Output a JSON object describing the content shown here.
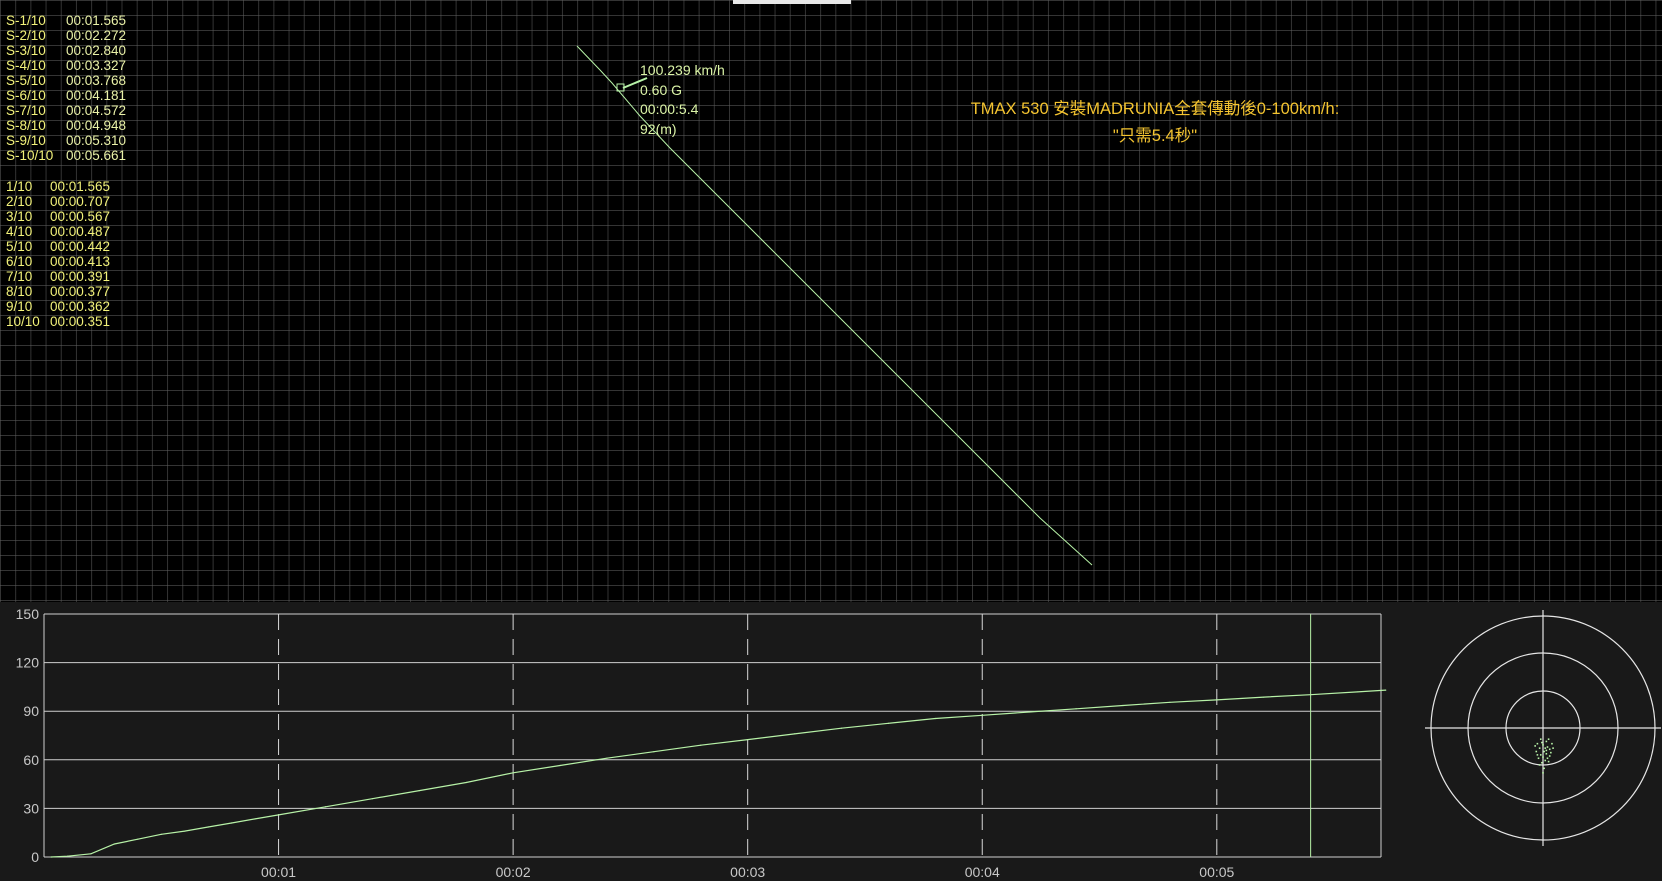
{
  "split_times": [
    {
      "label": "S-1/10",
      "time": "00:01.565"
    },
    {
      "label": "S-2/10",
      "time": "00:02.272"
    },
    {
      "label": "S-3/10",
      "time": "00:02.840"
    },
    {
      "label": "S-4/10",
      "time": "00:03.327"
    },
    {
      "label": "S-5/10",
      "time": "00:03.768"
    },
    {
      "label": "S-6/10",
      "time": "00:04.181"
    },
    {
      "label": "S-7/10",
      "time": "00:04.572"
    },
    {
      "label": "S-8/10",
      "time": "00:04.948"
    },
    {
      "label": "S-9/10",
      "time": "00:05.310"
    },
    {
      "label": "S-10/10",
      "time": "00:05.661"
    }
  ],
  "interval_times": [
    {
      "label": "1/10",
      "time": "00:01.565"
    },
    {
      "label": "2/10",
      "time": "00:00.707"
    },
    {
      "label": "3/10",
      "time": "00:00.567"
    },
    {
      "label": "4/10",
      "time": "00:00.487"
    },
    {
      "label": "5/10",
      "time": "00:00.442"
    },
    {
      "label": "6/10",
      "time": "00:00.413"
    },
    {
      "label": "7/10",
      "time": "00:00.391"
    },
    {
      "label": "8/10",
      "time": "00:00.377"
    },
    {
      "label": "9/10",
      "time": "00:00.362"
    },
    {
      "label": "10/10",
      "time": "00:00.351"
    }
  ],
  "cursor_readout": {
    "speed": "100.239 km/h",
    "gforce": "0.60 G",
    "time": "00:00:5.4",
    "distance": "92(m)"
  },
  "title": {
    "line1": "TMAX 530 安裝MADRUNIA全套傳動後0-100km/h:",
    "line2": "\"只需5.4秒\""
  },
  "colors": {
    "trace": "#b7f2a7",
    "split_label": "#f2f27a",
    "title": "#f4c430",
    "grid": "#5f5f5f",
    "panel_bg": "#191919"
  },
  "chart_data": {
    "type": "line",
    "xlabel": "",
    "ylabel": "",
    "xlim": [
      0,
      5.7
    ],
    "ylim": [
      0,
      150
    ],
    "y_ticks": [
      0,
      30,
      60,
      90,
      120,
      150
    ],
    "x_tick_values": [
      1,
      2,
      3,
      4,
      5
    ],
    "x_tick_labels": [
      "00:01",
      "00:02",
      "00:03",
      "00:04",
      "00:05"
    ],
    "cursor_x": 5.4,
    "series": [
      {
        "name": "",
        "x": [
          0.03,
          0.1,
          0.2,
          0.3,
          0.4,
          0.5,
          0.6,
          0.7,
          0.8,
          0.9,
          1.0,
          1.2,
          1.4,
          1.6,
          1.8,
          2.0,
          2.2,
          2.4,
          2.6,
          2.8,
          3.0,
          3.2,
          3.4,
          3.6,
          3.8,
          4.0,
          4.2,
          4.4,
          4.6,
          4.8,
          5.0,
          5.2,
          5.4,
          5.6,
          5.72
        ],
        "y": [
          0,
          0.5,
          2,
          8,
          11,
          14,
          16,
          18.5,
          21,
          23.5,
          26,
          31,
          36,
          41,
          46,
          52,
          56.5,
          61,
          65,
          69,
          72.5,
          76,
          79.5,
          82.5,
          85.5,
          87.5,
          89.5,
          91.5,
          93.5,
          95.5,
          97,
          98.7,
          100.2,
          101.9,
          103
        ]
      }
    ]
  },
  "gforce_scatter": {
    "points": [
      [
        -0.02,
        0.1
      ],
      [
        0.03,
        0.12
      ],
      [
        0.05,
        0.1
      ],
      [
        -0.05,
        0.14
      ],
      [
        0.0,
        0.15
      ],
      [
        0.04,
        0.17
      ],
      [
        -0.03,
        0.18
      ],
      [
        0.06,
        0.19
      ],
      [
        0.01,
        0.21
      ],
      [
        -0.06,
        0.21
      ],
      [
        0.03,
        0.23
      ],
      [
        -0.02,
        0.24
      ],
      [
        0.07,
        0.22
      ],
      [
        0.0,
        0.26
      ],
      [
        0.04,
        0.27
      ],
      [
        -0.04,
        0.27
      ],
      [
        0.02,
        0.29
      ],
      [
        -0.01,
        0.31
      ],
      [
        0.05,
        0.3
      ],
      [
        -0.07,
        0.16
      ],
      [
        0.08,
        0.14
      ],
      [
        0.02,
        0.18
      ],
      [
        -0.03,
        0.33
      ],
      [
        0.01,
        0.36
      ],
      [
        0.0,
        0.4
      ],
      [
        0.06,
        0.25
      ],
      [
        -0.05,
        0.24
      ],
      [
        0.03,
        0.2
      ],
      [
        -0.01,
        0.13
      ],
      [
        0.09,
        0.18
      ]
    ]
  }
}
